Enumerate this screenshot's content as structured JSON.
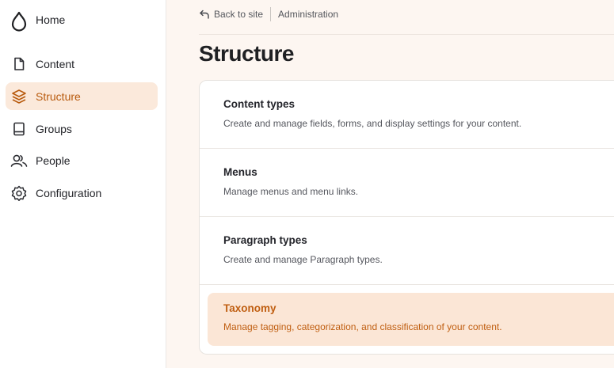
{
  "colors": {
    "accent": "#b85a0d",
    "active_bg": "#fbe9db",
    "main_bg": "#fdf6f1"
  },
  "sidebar": {
    "items": [
      {
        "label": "Home",
        "icon": "drop-icon"
      },
      {
        "label": "Content",
        "icon": "document-icon"
      },
      {
        "label": "Structure",
        "icon": "layers-icon",
        "active": true
      },
      {
        "label": "Groups",
        "icon": "book-icon"
      },
      {
        "label": "People",
        "icon": "people-icon"
      },
      {
        "label": "Configuration",
        "icon": "gear-icon"
      }
    ]
  },
  "breadcrumb": {
    "back_label": "Back to site",
    "current": "Administration"
  },
  "page": {
    "title": "Structure"
  },
  "structure_items": [
    {
      "title": "Content types",
      "description": "Create and manage fields, forms, and display settings for your content."
    },
    {
      "title": "Menus",
      "description": "Manage menus and menu links."
    },
    {
      "title": "Paragraph types",
      "description": "Create and manage Paragraph types."
    },
    {
      "title": "Taxonomy",
      "description": "Manage tagging, categorization, and classification of your content.",
      "active": true
    }
  ]
}
